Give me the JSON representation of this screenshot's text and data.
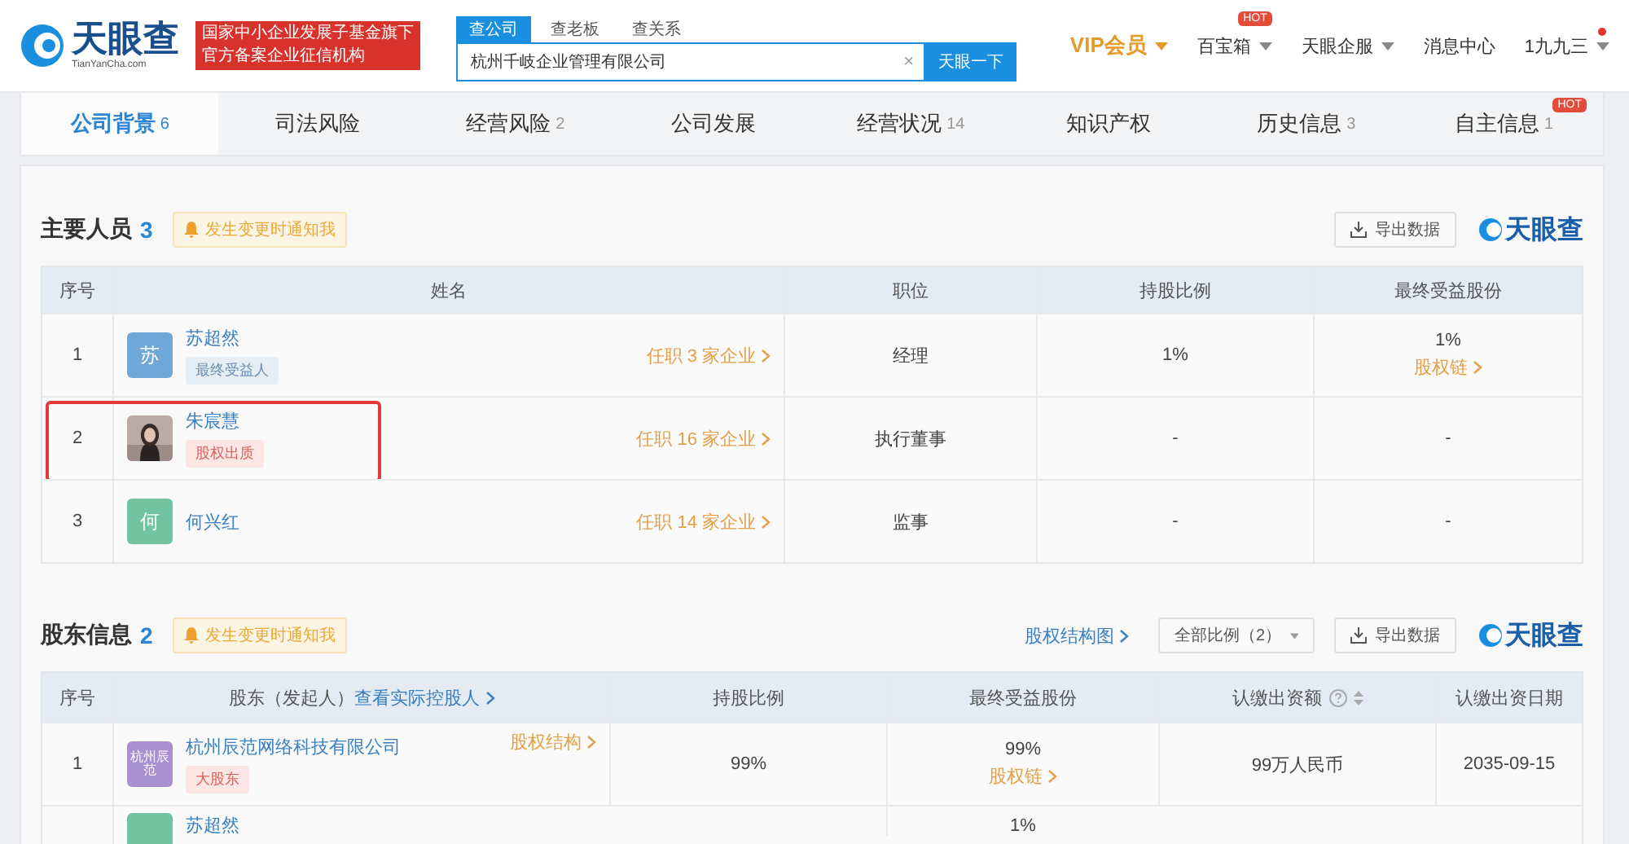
{
  "header": {
    "logo": "天眼查",
    "logo_sub": "TianYanCha.com",
    "banner": [
      "国家中小企业发展子基金旗下",
      "官方备案企业征信机构"
    ],
    "search_tabs": [
      {
        "label": "查公司",
        "selected": true
      },
      {
        "label": "查老板",
        "selected": false
      },
      {
        "label": "查关系",
        "selected": false
      }
    ],
    "search": {
      "value": "杭州千岐企业管理有限公司",
      "clear": "×",
      "button": "天眼一下"
    },
    "nav": [
      {
        "label": "VIP会员",
        "kind": "vip",
        "dropdown": true
      },
      {
        "label": "百宝箱",
        "kind": "plain",
        "dropdown": true,
        "badge": "HOT"
      },
      {
        "label": "天眼企服",
        "kind": "plain",
        "dropdown": true
      },
      {
        "label": "消息中心",
        "kind": "plain",
        "dropdown": false
      },
      {
        "label": "1九九三",
        "kind": "plain",
        "dropdown": true,
        "dot": true
      }
    ]
  },
  "tabs": [
    {
      "label": "公司背景",
      "count": "6",
      "selected": true
    },
    {
      "label": "司法风险",
      "selected": false
    },
    {
      "label": "经营风险",
      "count": "2",
      "selected": false
    },
    {
      "label": "公司发展",
      "selected": false
    },
    {
      "label": "经营状况",
      "count": "14",
      "selected": false
    },
    {
      "label": "知识产权",
      "selected": false
    },
    {
      "label": "历史信息",
      "count": "3",
      "selected": false
    },
    {
      "label": "自主信息",
      "count": "1",
      "badge": "HOT",
      "selected": false
    }
  ],
  "people": {
    "title": "主要人员",
    "count": "3",
    "notify": "发生变更时通知我",
    "export": "导出数据",
    "brand": "天眼查",
    "columns": [
      "序号",
      "姓名",
      "职位",
      "持股比例",
      "最终受益股份"
    ],
    "rows": [
      {
        "index": "1",
        "avatar": {
          "kind": "letter",
          "text": "苏",
          "color": "#6fa8d6"
        },
        "name": "苏超然",
        "tag": {
          "text": "最终受益人",
          "kind": "info"
        },
        "jobs": "任职 3 家企业",
        "position": "经理",
        "share": "1%",
        "beneficial": "1%",
        "chain": "股权链",
        "highlighted": false
      },
      {
        "index": "2",
        "name": "朱宸慧",
        "tag": {
          "text": "股权出质",
          "kind": "danger"
        },
        "jobs": "任职 16 家企业",
        "position": "执行董事",
        "share": "-",
        "beneficial": "-",
        "highlighted": true
      },
      {
        "index": "3",
        "avatar": {
          "kind": "letter",
          "text": "何",
          "color": "#72c3a2"
        },
        "name": "何兴红",
        "jobs": "任职 14 家企业",
        "position": "监事",
        "share": "-",
        "beneficial": "-",
        "highlighted": false
      }
    ]
  },
  "shareholders": {
    "title": "股东信息",
    "count": "2",
    "notify": "发生变更时通知我",
    "structure_link": "股权结构图",
    "filter": "全部比例（2）",
    "export": "导出数据",
    "brand": "天眼查",
    "columns": [
      {
        "label": "序号"
      },
      {
        "label": "股东（发起人）",
        "link": "查看实际控股人"
      },
      {
        "label": "持股比例"
      },
      {
        "label": "最终受益股份"
      },
      {
        "label": "认缴出资额",
        "help": true,
        "sortable": true
      },
      {
        "label": "认缴出资日期"
      }
    ],
    "rows": [
      {
        "index": "1",
        "avatar": {
          "kind": "letter",
          "text": "杭州辰范",
          "color": "#a88fcf"
        },
        "name": "杭州辰范网络科技有限公司",
        "tag": {
          "text": "大股东",
          "kind": "danger"
        },
        "structure": "股权结构",
        "share": "99%",
        "beneficial": "99%",
        "chain": "股权链",
        "amount": "99万人民币",
        "date": "2035-09-15"
      },
      {
        "avatar": {
          "kind": "letter",
          "color": "#72c3a2"
        },
        "name": "苏超然",
        "beneficial": "1%"
      }
    ]
  }
}
